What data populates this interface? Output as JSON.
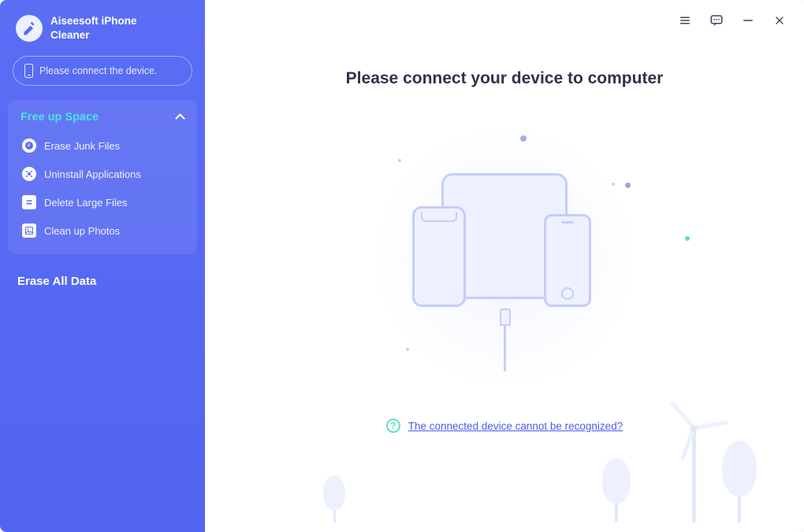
{
  "brand": {
    "line1": "Aiseesoft iPhone",
    "line2": "Cleaner"
  },
  "sidebar": {
    "connect_label": "Please connect the device.",
    "group_title": "Free up Space",
    "items": [
      {
        "label": "Erase Junk Files"
      },
      {
        "label": "Uninstall Applications"
      },
      {
        "label": "Delete Large Files"
      },
      {
        "label": "Clean up Photos"
      }
    ],
    "erase_all_label": "Erase All Data"
  },
  "main": {
    "headline": "Please connect your device to computer",
    "help_link": "The connected device cannot be recognized?"
  }
}
